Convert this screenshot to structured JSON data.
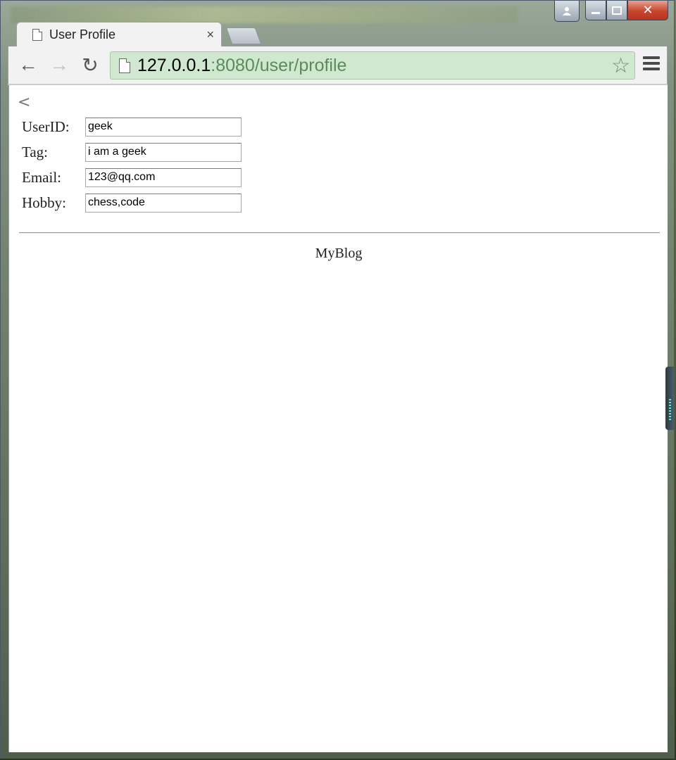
{
  "browser": {
    "tab_title": "User Profile",
    "tab_close": "×",
    "url_host": "127.0.0.1",
    "url_rest": ":8080/user/profile"
  },
  "icons": {
    "back": "←",
    "forward": "→",
    "reload": "↻",
    "star": "☆",
    "page_back": "<"
  },
  "window_controls": {
    "close": "✕"
  },
  "form": {
    "fields": [
      {
        "label": "UserID:",
        "value": "geek"
      },
      {
        "label": "Tag:",
        "value": "i am a geek"
      },
      {
        "label": "Email:",
        "value": "123@qq.com"
      },
      {
        "label": "Hobby:",
        "value": "chess,code"
      }
    ]
  },
  "footer": {
    "text": "MyBlog"
  }
}
